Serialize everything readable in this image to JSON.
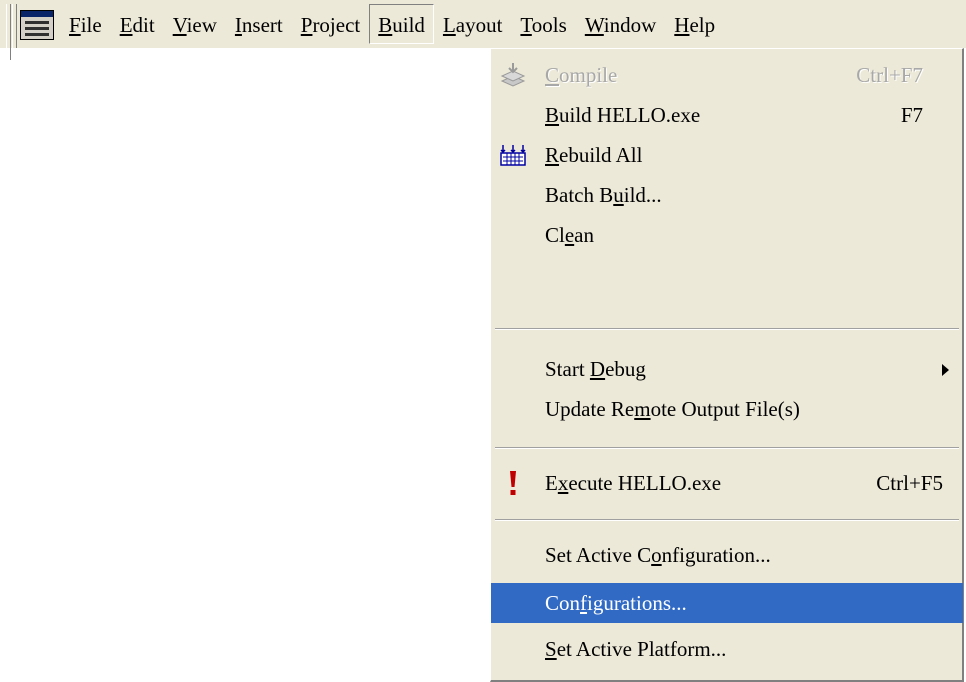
{
  "menubar": {
    "items": [
      {
        "pre": "",
        "u": "F",
        "post": "ile"
      },
      {
        "pre": "",
        "u": "E",
        "post": "dit"
      },
      {
        "pre": "",
        "u": "V",
        "post": "iew"
      },
      {
        "pre": "",
        "u": "I",
        "post": "nsert"
      },
      {
        "pre": "",
        "u": "P",
        "post": "roject"
      },
      {
        "pre": "",
        "u": "B",
        "post": "uild"
      },
      {
        "pre": "",
        "u": "L",
        "post": "ayout"
      },
      {
        "pre": "",
        "u": "T",
        "post": "ools"
      },
      {
        "pre": "",
        "u": "W",
        "post": "indow"
      },
      {
        "pre": "",
        "u": "H",
        "post": "elp"
      }
    ]
  },
  "build_menu": {
    "compile": {
      "pre": "",
      "u": "C",
      "post": "ompile",
      "shortcut": "Ctrl+F7",
      "icon": "compile-icon"
    },
    "build": {
      "pre": "",
      "u": "B",
      "post": "uild HELLO.exe",
      "shortcut": "F7"
    },
    "rebuild": {
      "pre": "",
      "u": "R",
      "post": "ebuild All",
      "icon": "rebuild-icon"
    },
    "batch": {
      "pre": "Batch B",
      "u": "u",
      "post": "ild..."
    },
    "clean": {
      "pre": "Cl",
      "u": "e",
      "post": "an"
    },
    "start_debug": {
      "pre": "Start ",
      "u": "D",
      "post": "ebug"
    },
    "update_remote": {
      "pre": "Update Re",
      "u": "m",
      "post": "ote Output File(s)"
    },
    "execute": {
      "pre": "E",
      "u": "x",
      "post": "ecute HELLO.exe",
      "shortcut": "Ctrl+F5",
      "icon": "exclamation-icon"
    },
    "set_active_config": {
      "pre": "Set Active C",
      "u": "o",
      "post": "nfiguration..."
    },
    "configurations": {
      "pre": "Con",
      "u": "f",
      "post": "igurations..."
    },
    "set_active_platform": {
      "pre": "",
      "u": "S",
      "post": "et Active Platform..."
    }
  },
  "colors": {
    "menu_bg": "#ece9d8",
    "highlight": "#316ac5",
    "disabled_text": "#a8a8a8",
    "execute_icon": "#c00000"
  }
}
